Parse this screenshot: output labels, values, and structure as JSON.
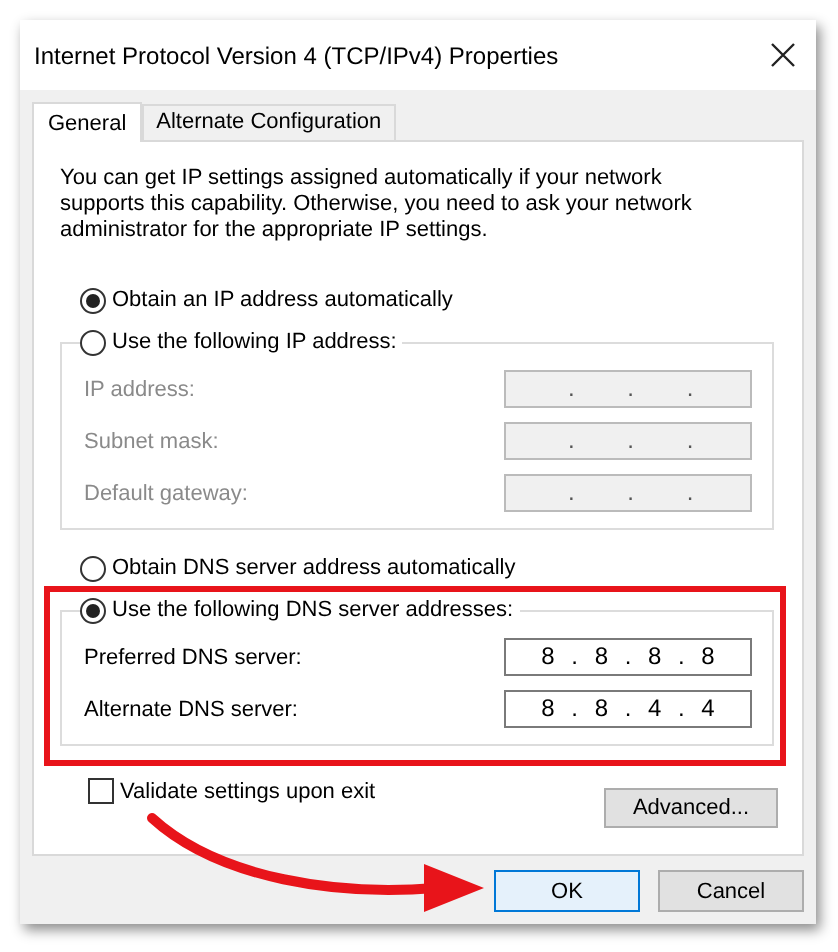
{
  "window": {
    "title": "Internet Protocol Version 4 (TCP/IPv4) Properties"
  },
  "tabs": [
    {
      "label": "General",
      "selected": true
    },
    {
      "label": "Alternate Configuration",
      "selected": false
    }
  ],
  "description": "You can get IP settings assigned automatically if your network supports this capability. Otherwise, you need to ask your network administrator for the appropriate IP settings.",
  "ip_section": {
    "auto_option": {
      "label": "Obtain an IP address automatically",
      "selected": true
    },
    "manual_option": {
      "label": "Use the following IP address:",
      "selected": false
    },
    "fields": [
      {
        "label": "IP address:",
        "value": ". . .",
        "disabled": true
      },
      {
        "label": "Subnet mask:",
        "value": ". . .",
        "disabled": true
      },
      {
        "label": "Default gateway:",
        "value": ". . .",
        "disabled": true
      }
    ]
  },
  "dns_section": {
    "auto_option": {
      "label": "Obtain DNS server address automatically",
      "selected": false
    },
    "manual_option": {
      "label": "Use the following DNS server addresses:",
      "selected": true
    },
    "fields": [
      {
        "label": "Preferred DNS server:",
        "value": "8 . 8 . 8 . 8",
        "disabled": false
      },
      {
        "label": "Alternate DNS server:",
        "value": "8 . 8 . 4 . 4",
        "disabled": false
      }
    ]
  },
  "validate": {
    "label": "Validate settings upon exit",
    "checked": false
  },
  "advanced_button": {
    "label": "Advanced..."
  },
  "buttons": [
    {
      "label": "OK",
      "kind": "default"
    },
    {
      "label": "Cancel",
      "kind": "normal"
    }
  ],
  "annotations": [
    {
      "kind": "highlight-box"
    },
    {
      "kind": "arrow"
    }
  ]
}
